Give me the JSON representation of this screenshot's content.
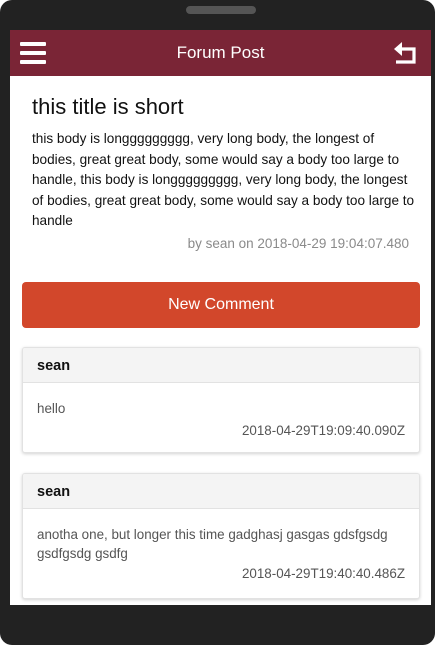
{
  "appbar": {
    "title": "Forum Post"
  },
  "post": {
    "title": "this title is short",
    "body": "this body is longgggggggg, very long body, the longest of bodies, great great body, some would say a body too large to handle, this body is longgggggggg, very long body, the longest of bodies, great great body, some would say a body too large to handle",
    "meta": "by sean on 2018-04-29 19:04:07.480"
  },
  "actions": {
    "new_comment_label": "New Comment"
  },
  "comments": [
    {
      "author": "sean",
      "text": "hello",
      "date": "2018-04-29T19:09:40.090Z"
    },
    {
      "author": "sean",
      "text": "anotha one, but longer this time gadghasj gasgas gdsfgsdg gsdfgsdg gsdfg",
      "date": "2018-04-29T19:40:40.486Z"
    }
  ],
  "colors": {
    "appbar": "#7a2536",
    "accent_button": "#d2472b",
    "meta_text": "#8a8a8a"
  },
  "icons": {
    "menu": "hamburger-menu-icon",
    "back": "return-arrow-icon"
  }
}
